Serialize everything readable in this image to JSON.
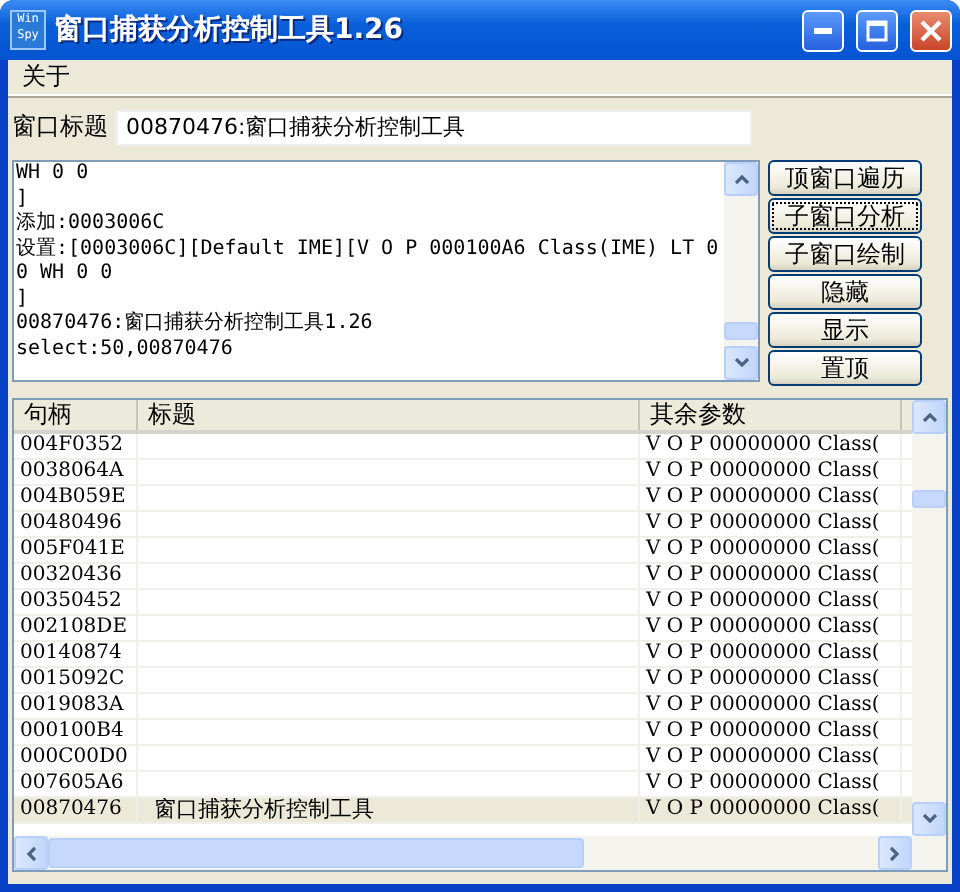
{
  "window": {
    "title": "窗口捕获分析控制工具1.26",
    "icon_text": [
      "Win",
      "Spy"
    ]
  },
  "menu": [
    "关于"
  ],
  "title_field": {
    "label": "窗口标题",
    "value": "00870476:窗口捕获分析控制工具"
  },
  "log_lines": [
    "WH 0 0",
    "]",
    "添加:0003006C",
    "设置:[0003006C][Default IME][V O P 000100A6 Class(IME) LT 0",
    "0 WH 0 0",
    "]",
    "00870476:窗口捕获分析控制工具1.26",
    "select:50,00870476"
  ],
  "buttons": [
    {
      "label": "顶窗口遍历",
      "focused": false
    },
    {
      "label": "子窗口分析",
      "focused": true
    },
    {
      "label": "子窗口绘制",
      "focused": false
    },
    {
      "label": "隐藏",
      "focused": false
    },
    {
      "label": "显示",
      "focused": false
    },
    {
      "label": "置顶",
      "focused": false
    }
  ],
  "table": {
    "columns": [
      "句柄",
      "标题",
      "其余参数"
    ],
    "rows": [
      {
        "cells": [
          "004F0352",
          "",
          "V O P 00000000 Class("
        ],
        "selected": false
      },
      {
        "cells": [
          "0038064A",
          "",
          "V O P 00000000 Class("
        ],
        "selected": false
      },
      {
        "cells": [
          "004B059E",
          "",
          "V O P 00000000 Class("
        ],
        "selected": false
      },
      {
        "cells": [
          "00480496",
          "",
          "V O P 00000000 Class("
        ],
        "selected": false
      },
      {
        "cells": [
          "005F041E",
          "",
          "V O P 00000000 Class("
        ],
        "selected": false
      },
      {
        "cells": [
          "00320436",
          "",
          "V O P 00000000 Class("
        ],
        "selected": false
      },
      {
        "cells": [
          "00350452",
          "",
          "V O P 00000000 Class("
        ],
        "selected": false
      },
      {
        "cells": [
          "002108DE",
          "",
          "V O P 00000000 Class("
        ],
        "selected": false
      },
      {
        "cells": [
          "00140874",
          "",
          "V O P 00000000 Class("
        ],
        "selected": false
      },
      {
        "cells": [
          "0015092C",
          "",
          "V O P 00000000 Class("
        ],
        "selected": false
      },
      {
        "cells": [
          "0019083A",
          "",
          "V O P 00000000 Class("
        ],
        "selected": false
      },
      {
        "cells": [
          "000100B4",
          "",
          "V O P 00000000 Class("
        ],
        "selected": false
      },
      {
        "cells": [
          "000C00D0",
          "",
          "V O P 00000000 Class("
        ],
        "selected": false
      },
      {
        "cells": [
          "007605A6",
          "",
          "V O P 00000000 Class("
        ],
        "selected": false
      },
      {
        "cells": [
          "00870476",
          "窗口捕获分析控制工具",
          "V O P 00000000 Class("
        ],
        "selected": true
      }
    ]
  }
}
